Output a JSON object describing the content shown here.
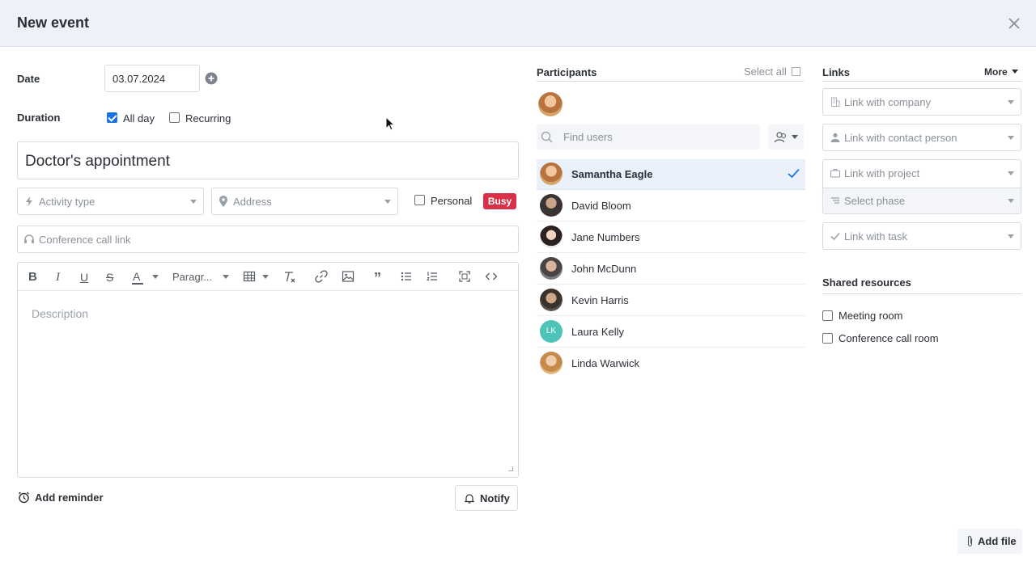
{
  "header": {
    "title": "New event"
  },
  "form": {
    "date_label": "Date",
    "date_value": "03.07.2024",
    "duration_label": "Duration",
    "all_day_label": "All day",
    "recurring_label": "Recurring",
    "title_value": "Doctor's appointment",
    "activity_type_placeholder": "Activity type",
    "address_placeholder": "Address",
    "personal_label": "Personal",
    "busy_badge": "Busy",
    "conference_placeholder": "Conference call link",
    "toolbar": {
      "paragraph_label": "Paragr..."
    },
    "description_placeholder": "Description",
    "add_reminder_label": "Add reminder",
    "notify_label": "Notify"
  },
  "participants": {
    "title": "Participants",
    "select_all_label": "Select all",
    "search_placeholder": "Find users",
    "users": [
      {
        "name": "Samantha Eagle",
        "selected": true
      },
      {
        "name": "David Bloom"
      },
      {
        "name": "Jane Numbers"
      },
      {
        "name": "John McDunn"
      },
      {
        "name": "Kevin Harris"
      },
      {
        "name": "Laura Kelly",
        "initials": "LK"
      },
      {
        "name": "Linda Warwick"
      }
    ]
  },
  "links": {
    "title": "Links",
    "more_label": "More",
    "company_placeholder": "Link with company",
    "contact_placeholder": "Link with contact person",
    "project_placeholder": "Link with project",
    "phase_placeholder": "Select phase",
    "task_placeholder": "Link with task"
  },
  "resources": {
    "title": "Shared resources",
    "meeting_room_label": "Meeting room",
    "conference_room_label": "Conference call room"
  },
  "footer": {
    "add_file_label": "Add file"
  },
  "colors": {
    "accent": "#1a73e8",
    "busy": "#d9304a",
    "lk_avatar": "#4fc3b8"
  }
}
